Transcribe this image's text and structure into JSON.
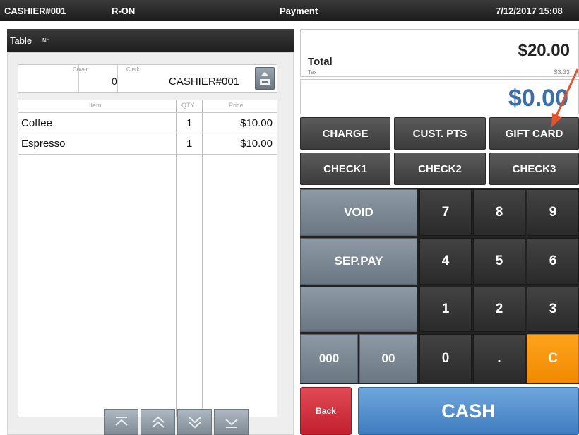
{
  "topbar": {
    "cashier": "CASHIER#001",
    "mode": "R-ON",
    "screen_title": "Payment",
    "datetime": "7/12/2017 15:08"
  },
  "table_bar": {
    "label": "Table",
    "number_label": "No."
  },
  "info": {
    "cover_label": "Cover",
    "cover_value": "0",
    "clerk_label": "Clerk",
    "clerk_value": "CASHIER#001",
    "clerk_button_icon": "clerk-select-icon"
  },
  "items": {
    "headers": {
      "item": "Item",
      "qty": "QTY",
      "price": "Price"
    },
    "rows": [
      {
        "name": "Coffee",
        "qty": "1",
        "price": "$10.00"
      },
      {
        "name": "Espresso",
        "qty": "1",
        "price": "$10.00"
      }
    ]
  },
  "scroll_buttons": [
    {
      "icon": "scroll-top-icon",
      "glyph": "⌅"
    },
    {
      "icon": "page-up-icon",
      "glyph": "︽"
    },
    {
      "icon": "page-down-icon",
      "glyph": "︾"
    },
    {
      "icon": "scroll-bottom-icon",
      "glyph": "⌄"
    }
  ],
  "totals": {
    "total_label": "Total",
    "total_value": "$20.00",
    "tax_label": "Tax",
    "tax_value": "$3.33",
    "tender_value": "$0.00"
  },
  "tender_buttons": {
    "row1": [
      "CHARGE",
      "CUST. PTS",
      "GIFT CARD"
    ],
    "row2": [
      "CHECK1",
      "CHECK2",
      "CHECK3"
    ]
  },
  "keypad": {
    "void": "VOID",
    "sep_pay": "SEP.PAY",
    "blank": "",
    "k000": "000",
    "k00": "00",
    "digits": [
      "7",
      "8",
      "9",
      "4",
      "5",
      "6",
      "1",
      "2",
      "3"
    ],
    "k0": "0",
    "dot": ".",
    "clear": "C"
  },
  "bottom": {
    "back": "Back",
    "cash": "CASH"
  },
  "colors": {
    "accent_blue": "#3c6fa8",
    "clear_orange": "#f59300",
    "back_red": "#d22f3c",
    "annotation_arrow": "#e8522a"
  }
}
